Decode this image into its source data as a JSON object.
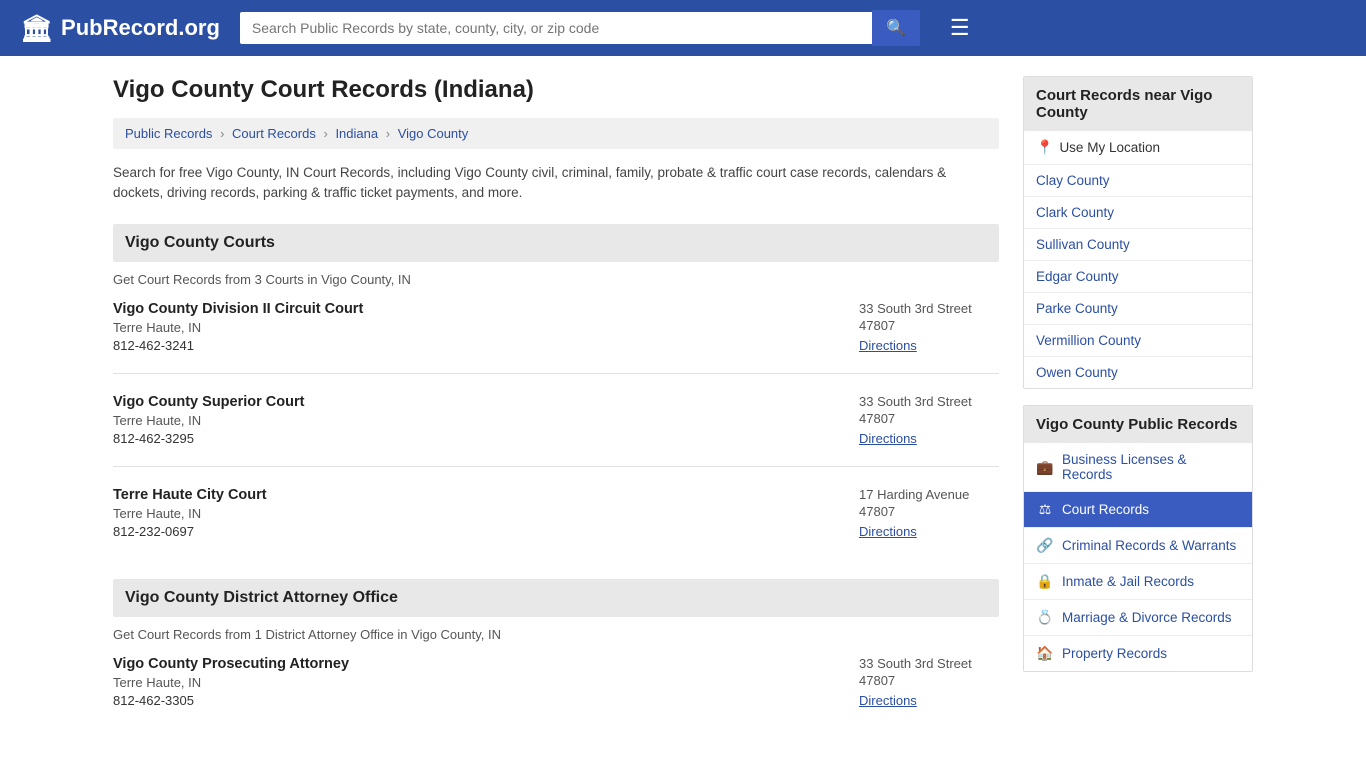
{
  "header": {
    "logo_icon": "🏛",
    "logo_text": "PubRecord.org",
    "search_placeholder": "Search Public Records by state, county, city, or zip code",
    "search_icon": "🔍",
    "menu_icon": "☰"
  },
  "page": {
    "title": "Vigo County Court Records (Indiana)",
    "breadcrumb": [
      {
        "label": "Public Records",
        "href": "#"
      },
      {
        "label": "Court Records",
        "href": "#"
      },
      {
        "label": "Indiana",
        "href": "#"
      },
      {
        "label": "Vigo County",
        "href": "#"
      }
    ],
    "description": "Search for free Vigo County, IN Court Records, including Vigo County civil, criminal, family, probate & traffic court case records, calendars & dockets, driving records, parking & traffic ticket payments, and more."
  },
  "courts_section": {
    "header": "Vigo County Courts",
    "description": "Get Court Records from 3 Courts in Vigo County, IN",
    "courts": [
      {
        "name": "Vigo County Division II Circuit Court",
        "city": "Terre Haute, IN",
        "phone": "812-462-3241",
        "address": "33 South 3rd Street",
        "zip": "47807",
        "directions_label": "Directions"
      },
      {
        "name": "Vigo County Superior Court",
        "city": "Terre Haute, IN",
        "phone": "812-462-3295",
        "address": "33 South 3rd Street",
        "zip": "47807",
        "directions_label": "Directions"
      },
      {
        "name": "Terre Haute City Court",
        "city": "Terre Haute, IN",
        "phone": "812-232-0697",
        "address": "17 Harding Avenue",
        "zip": "47807",
        "directions_label": "Directions"
      }
    ]
  },
  "da_section": {
    "header": "Vigo County District Attorney Office",
    "description": "Get Court Records from 1 District Attorney Office in Vigo County, IN",
    "courts": [
      {
        "name": "Vigo County Prosecuting Attorney",
        "city": "Terre Haute, IN",
        "phone": "812-462-3305",
        "address": "33 South 3rd Street",
        "zip": "47807",
        "directions_label": "Directions"
      }
    ]
  },
  "sidebar": {
    "nearby_title": "Court Records near Vigo County",
    "use_location_icon": "📍",
    "use_location_label": "Use My Location",
    "nearby_counties": [
      "Clay County",
      "Clark County",
      "Sullivan County",
      "Edgar County",
      "Parke County",
      "Vermillion County",
      "Owen County"
    ],
    "public_records_title": "Vigo County Public Records",
    "public_records_items": [
      {
        "icon": "💼",
        "label": "Business Licenses & Records",
        "active": false
      },
      {
        "icon": "⚖",
        "label": "Court Records",
        "active": true
      },
      {
        "icon": "🔗",
        "label": "Criminal Records & Warrants",
        "active": false
      },
      {
        "icon": "🔒",
        "label": "Inmate & Jail Records",
        "active": false
      },
      {
        "icon": "💍",
        "label": "Marriage & Divorce Records",
        "active": false
      },
      {
        "icon": "🏠",
        "label": "Property Records",
        "active": false
      }
    ]
  }
}
